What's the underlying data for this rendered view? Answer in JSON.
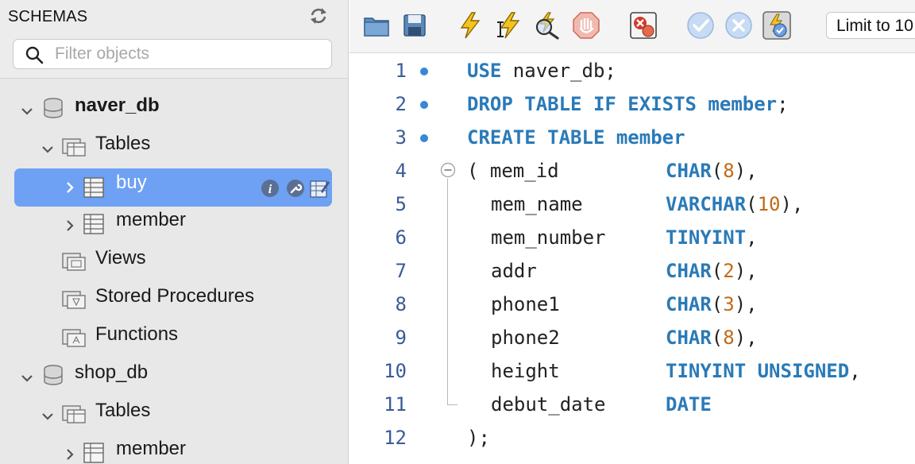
{
  "sidebar": {
    "title": "SCHEMAS",
    "filter_placeholder": "Filter objects",
    "tree": {
      "naver_db": "naver_db",
      "naver_tables": "Tables",
      "buy": "buy",
      "member": "member",
      "views": "Views",
      "stored_procedures": "Stored Procedures",
      "functions": "Functions",
      "shop_db": "shop_db",
      "shop_tables": "Tables",
      "shop_member": "member"
    }
  },
  "toolbar": {
    "limit_label": "Limit to 10"
  },
  "editor": {
    "line_numbers": [
      "1",
      "2",
      "3",
      "4",
      "5",
      "6",
      "7",
      "8",
      "9",
      "10",
      "11",
      "12"
    ],
    "lines": {
      "l1": {
        "kw": "USE",
        "rest": " naver_db;"
      },
      "l2": {
        "kw": "DROP TABLE IF EXISTS member",
        "rest": ";"
      },
      "l3": {
        "kw": "CREATE TABLE member"
      },
      "l4": {
        "col": "( mem_id",
        "type": "CHAR",
        "open": "(",
        "num": "8",
        "close": "),"
      },
      "l5": {
        "col": "mem_name",
        "type": "VARCHAR",
        "open": "(",
        "num": "10",
        "close": "),"
      },
      "l6": {
        "col": "mem_number",
        "type": "TINYINT",
        "close": ","
      },
      "l7": {
        "col": "addr",
        "type": "CHAR",
        "open": "(",
        "num": "2",
        "close": "),"
      },
      "l8": {
        "col": "phone1",
        "type": "CHAR",
        "open": "(",
        "num": "3",
        "close": "),"
      },
      "l9": {
        "col": "phone2",
        "type": "CHAR",
        "open": "(",
        "num": "8",
        "close": "),"
      },
      "l10": {
        "col": "height",
        "type": "TINYINT UNSIGNED",
        "close": ","
      },
      "l11": {
        "col": "debut_date",
        "type": "DATE"
      },
      "l12": {
        "text": ");"
      }
    }
  },
  "icons": {
    "folder": "folder-icon",
    "save": "save-icon",
    "execute": "lightning-icon",
    "execute_current": "lightning-cursor-icon",
    "explain": "magnifier-icon",
    "stop": "stop-icon",
    "error_toggle": "error-stop-icon",
    "commit": "check-icon",
    "rollback": "x-icon",
    "autocommit": "autocommit-icon"
  },
  "colors": {
    "selection": "#6ea1f3",
    "keyword": "#2a7ab8",
    "number": "#c06a18",
    "line_number": "#3a5a9a"
  }
}
